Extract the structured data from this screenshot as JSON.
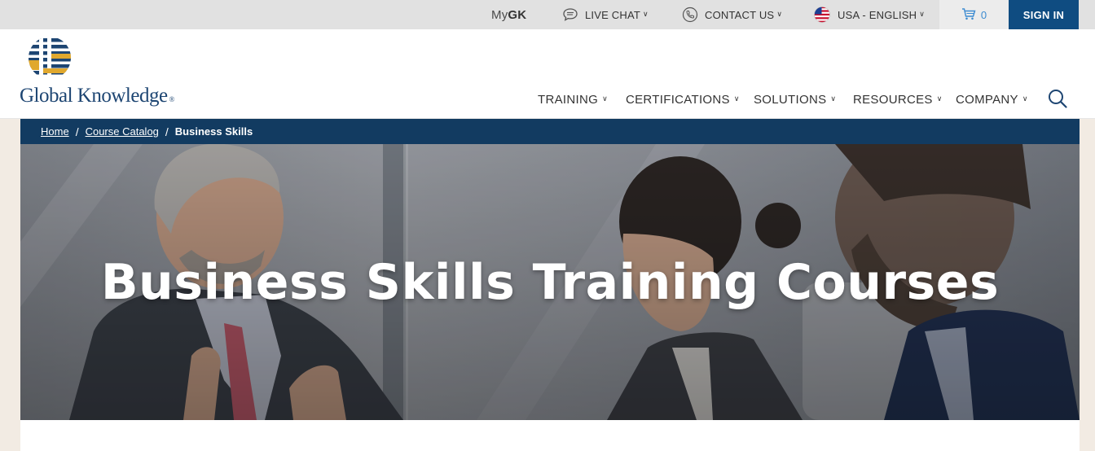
{
  "utility": {
    "mygk_prefix": "My",
    "mygk_bold": "GK",
    "live_chat": "LIVE CHAT",
    "contact_us": "CONTACT US",
    "locale": "USA - ENGLISH",
    "cart_count": "0",
    "sign_in": "SIGN IN"
  },
  "logo": {
    "text": "Global Knowledge",
    "reg": "®"
  },
  "nav": {
    "items": [
      {
        "label": "TRAINING"
      },
      {
        "label": "CERTIFICATIONS"
      },
      {
        "label": "SOLUTIONS"
      },
      {
        "label": "RESOURCES"
      },
      {
        "label": "COMPANY"
      }
    ]
  },
  "breadcrumb": {
    "home": "Home",
    "catalog": "Course Catalog",
    "current": "Business Skills",
    "separator": "/"
  },
  "hero": {
    "title": "Business Skills Training Courses"
  },
  "colors": {
    "brand_navy": "#0f4c81",
    "breadcrumb_bg": "#123b61",
    "cart_blue": "#3c8bd1",
    "logo_gold": "#e0a82e"
  },
  "icons": [
    "chat-icon",
    "phone-icon",
    "us-flag-icon",
    "cart-icon",
    "search-icon",
    "chevron-down-icon"
  ]
}
